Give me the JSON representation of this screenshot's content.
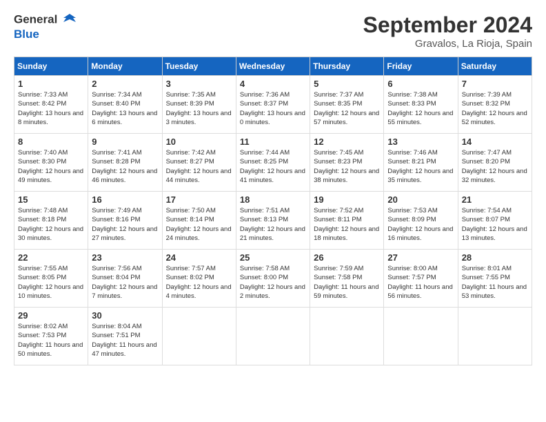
{
  "header": {
    "logo_line1": "General",
    "logo_line2": "Blue",
    "month": "September 2024",
    "location": "Gravalos, La Rioja, Spain"
  },
  "days_of_week": [
    "Sunday",
    "Monday",
    "Tuesday",
    "Wednesday",
    "Thursday",
    "Friday",
    "Saturday"
  ],
  "weeks": [
    [
      {
        "day": 1,
        "sunrise": "7:33 AM",
        "sunset": "8:42 PM",
        "daylight": "13 hours and 8 minutes."
      },
      {
        "day": 2,
        "sunrise": "7:34 AM",
        "sunset": "8:40 PM",
        "daylight": "13 hours and 6 minutes."
      },
      {
        "day": 3,
        "sunrise": "7:35 AM",
        "sunset": "8:39 PM",
        "daylight": "13 hours and 3 minutes."
      },
      {
        "day": 4,
        "sunrise": "7:36 AM",
        "sunset": "8:37 PM",
        "daylight": "13 hours and 0 minutes."
      },
      {
        "day": 5,
        "sunrise": "7:37 AM",
        "sunset": "8:35 PM",
        "daylight": "12 hours and 57 minutes."
      },
      {
        "day": 6,
        "sunrise": "7:38 AM",
        "sunset": "8:33 PM",
        "daylight": "12 hours and 55 minutes."
      },
      {
        "day": 7,
        "sunrise": "7:39 AM",
        "sunset": "8:32 PM",
        "daylight": "12 hours and 52 minutes."
      }
    ],
    [
      {
        "day": 8,
        "sunrise": "7:40 AM",
        "sunset": "8:30 PM",
        "daylight": "12 hours and 49 minutes."
      },
      {
        "day": 9,
        "sunrise": "7:41 AM",
        "sunset": "8:28 PM",
        "daylight": "12 hours and 46 minutes."
      },
      {
        "day": 10,
        "sunrise": "7:42 AM",
        "sunset": "8:27 PM",
        "daylight": "12 hours and 44 minutes."
      },
      {
        "day": 11,
        "sunrise": "7:44 AM",
        "sunset": "8:25 PM",
        "daylight": "12 hours and 41 minutes."
      },
      {
        "day": 12,
        "sunrise": "7:45 AM",
        "sunset": "8:23 PM",
        "daylight": "12 hours and 38 minutes."
      },
      {
        "day": 13,
        "sunrise": "7:46 AM",
        "sunset": "8:21 PM",
        "daylight": "12 hours and 35 minutes."
      },
      {
        "day": 14,
        "sunrise": "7:47 AM",
        "sunset": "8:20 PM",
        "daylight": "12 hours and 32 minutes."
      }
    ],
    [
      {
        "day": 15,
        "sunrise": "7:48 AM",
        "sunset": "8:18 PM",
        "daylight": "12 hours and 30 minutes."
      },
      {
        "day": 16,
        "sunrise": "7:49 AM",
        "sunset": "8:16 PM",
        "daylight": "12 hours and 27 minutes."
      },
      {
        "day": 17,
        "sunrise": "7:50 AM",
        "sunset": "8:14 PM",
        "daylight": "12 hours and 24 minutes."
      },
      {
        "day": 18,
        "sunrise": "7:51 AM",
        "sunset": "8:13 PM",
        "daylight": "12 hours and 21 minutes."
      },
      {
        "day": 19,
        "sunrise": "7:52 AM",
        "sunset": "8:11 PM",
        "daylight": "12 hours and 18 minutes."
      },
      {
        "day": 20,
        "sunrise": "7:53 AM",
        "sunset": "8:09 PM",
        "daylight": "12 hours and 16 minutes."
      },
      {
        "day": 21,
        "sunrise": "7:54 AM",
        "sunset": "8:07 PM",
        "daylight": "12 hours and 13 minutes."
      }
    ],
    [
      {
        "day": 22,
        "sunrise": "7:55 AM",
        "sunset": "8:05 PM",
        "daylight": "12 hours and 10 minutes."
      },
      {
        "day": 23,
        "sunrise": "7:56 AM",
        "sunset": "8:04 PM",
        "daylight": "12 hours and 7 minutes."
      },
      {
        "day": 24,
        "sunrise": "7:57 AM",
        "sunset": "8:02 PM",
        "daylight": "12 hours and 4 minutes."
      },
      {
        "day": 25,
        "sunrise": "7:58 AM",
        "sunset": "8:00 PM",
        "daylight": "12 hours and 2 minutes."
      },
      {
        "day": 26,
        "sunrise": "7:59 AM",
        "sunset": "7:58 PM",
        "daylight": "11 hours and 59 minutes."
      },
      {
        "day": 27,
        "sunrise": "8:00 AM",
        "sunset": "7:57 PM",
        "daylight": "11 hours and 56 minutes."
      },
      {
        "day": 28,
        "sunrise": "8:01 AM",
        "sunset": "7:55 PM",
        "daylight": "11 hours and 53 minutes."
      }
    ],
    [
      {
        "day": 29,
        "sunrise": "8:02 AM",
        "sunset": "7:53 PM",
        "daylight": "11 hours and 50 minutes."
      },
      {
        "day": 30,
        "sunrise": "8:04 AM",
        "sunset": "7:51 PM",
        "daylight": "11 hours and 47 minutes."
      },
      null,
      null,
      null,
      null,
      null
    ]
  ]
}
